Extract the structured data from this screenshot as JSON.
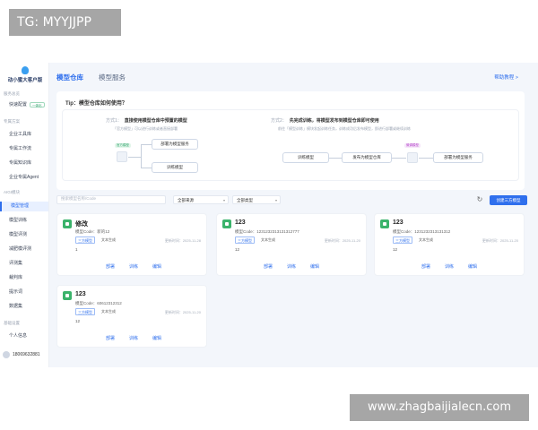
{
  "watermark_top": "TG: MYYJJPP",
  "watermark_bottom": "www.zhagbaijialecn.com",
  "sidebar": {
    "logo_text": "动小蜜大客户版",
    "groups": [
      {
        "label": "服务总览"
      },
      {
        "label": "专属方案"
      },
      {
        "label": "AIGI模块"
      },
      {
        "label": "基础设置"
      }
    ],
    "items": [
      {
        "label": "快速配置",
        "tag": "一体化"
      },
      {
        "label": "企业工具库"
      },
      {
        "label": "专属工作流"
      },
      {
        "label": "专属知识库"
      },
      {
        "label": "企业专属Agent"
      },
      {
        "label": "模型管理"
      },
      {
        "label": "模型训练"
      },
      {
        "label": "模型评测"
      },
      {
        "label": "减肥模评测"
      },
      {
        "label": "评测集"
      },
      {
        "label": "裁判库"
      },
      {
        "label": "提示词"
      },
      {
        "label": "数据集"
      },
      {
        "label": "个人信息"
      }
    ],
    "user_phone": "18069632881"
  },
  "topbar": {
    "tabs": [
      {
        "label": "模型仓库"
      },
      {
        "label": "模型服务"
      }
    ],
    "help_link": "帮助教程 >"
  },
  "tip": {
    "title": "Tip：模型仓库如何使用？",
    "method1": {
      "index": "方式1：",
      "title": "直接使用模型仓库中预置的模型",
      "desc": "「官方模型」可以进行训练或者直接部署",
      "cube_label": "官方模型",
      "deploy": "部署为模型服务",
      "train": "训练模型"
    },
    "method2": {
      "index": "方式2：",
      "title": "先完成训练，将模型发布到模型仓库即可使用",
      "desc": "前往「模型训练」模块发起训练任务，训练成功后发布模型，即进行部署或继续训练",
      "train": "训练模型",
      "publish": "发布为模型仓库",
      "cube_label": "微调模型",
      "deploy": "部署为模型服务"
    }
  },
  "toolbar": {
    "search_placeholder": "搜索模型名称/Code",
    "source_select": "全部来源",
    "type_select": "全部类型",
    "create_button": "创建三方模型"
  },
  "cards": [
    {
      "name": "修改",
      "code": "模型Code：新的12",
      "tag": "三方模型",
      "type": "文本生成",
      "time": "更新时间：2025-11-28",
      "desc": "1",
      "actions": [
        "部署",
        "训练",
        "编辑"
      ]
    },
    {
      "name": "123",
      "code": "模型Code：1231232313131312777",
      "tag": "三方模型",
      "type": "文本生成",
      "time": "更新时间：2025-11-20",
      "desc": "12",
      "actions": [
        "部署",
        "训练",
        "编辑"
      ]
    },
    {
      "name": "123",
      "code": "模型Code：1231232313131312",
      "tag": "三方模型",
      "type": "文本生成",
      "time": "更新时间：2025-11-20",
      "desc": "12",
      "actions": [
        "部署",
        "训练",
        "编辑"
      ]
    },
    {
      "name": "123",
      "code": "模型Code：60612312312",
      "tag": "三方模型",
      "type": "文本生成",
      "time": "更新时间：2025-11-20",
      "desc": "12",
      "actions": [
        "部署",
        "训练",
        "编辑"
      ]
    }
  ],
  "colors": {
    "accent": "#2f6fed",
    "card_icon": "#3bb36b",
    "background": "#f3f6fb"
  }
}
